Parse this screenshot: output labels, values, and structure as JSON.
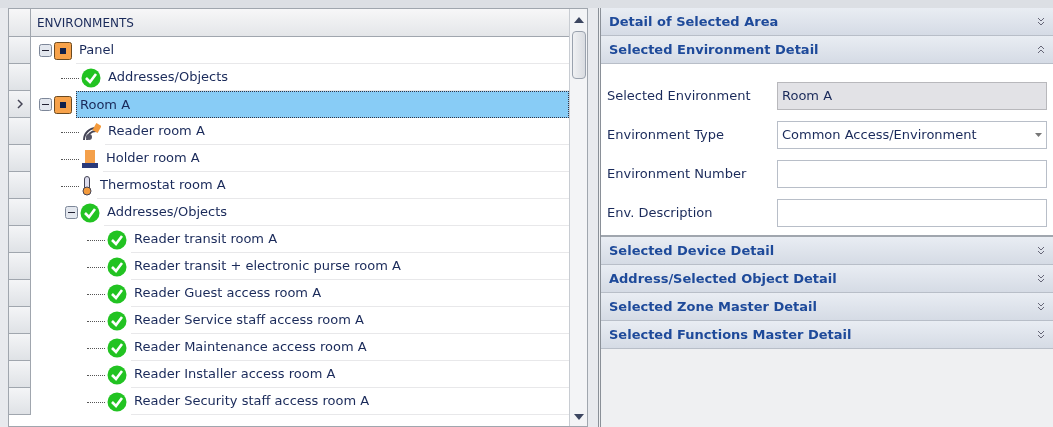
{
  "tree": {
    "header": "ENVIRONMENTS",
    "nodes": [
      {
        "label": "Panel",
        "kind": "panel",
        "expanded": true,
        "selected": false,
        "children": [
          {
            "label": "Addresses/Objects",
            "kind": "check",
            "selected": false
          }
        ]
      },
      {
        "label": "Room A",
        "kind": "panel",
        "expanded": true,
        "selected": true,
        "children": [
          {
            "label": "Reader room A",
            "kind": "reader",
            "selected": false
          },
          {
            "label": "Holder room A",
            "kind": "holder",
            "selected": false
          },
          {
            "label": "Thermostat room A",
            "kind": "thermostat",
            "selected": false
          },
          {
            "label": "Addresses/Objects",
            "kind": "check",
            "expanded": true,
            "selected": false,
            "children": [
              {
                "label": "Reader transit room A",
                "kind": "check",
                "selected": false
              },
              {
                "label": "Reader transit + electronic purse room A",
                "kind": "check",
                "selected": false
              },
              {
                "label": "Reader Guest access room A",
                "kind": "check",
                "selected": false
              },
              {
                "label": "Reader Service staff access room A",
                "kind": "check",
                "selected": false
              },
              {
                "label": "Reader Maintenance access room A",
                "kind": "check",
                "selected": false
              },
              {
                "label": "Reader Installer access room A",
                "kind": "check",
                "selected": false
              },
              {
                "label": "Reader Security staff access room A",
                "kind": "check",
                "selected": false
              }
            ]
          }
        ]
      }
    ]
  },
  "sections": [
    {
      "title": "Detail of Selected Area",
      "expanded": false
    },
    {
      "title": "Selected Environment Detail",
      "expanded": true,
      "fields": [
        {
          "label": "Selected Environment",
          "kind": "readonly",
          "value": "Room A"
        },
        {
          "label": "Environment Type",
          "kind": "dropdown",
          "value": "Common Access/Environment"
        },
        {
          "label": "Environment Number",
          "kind": "text"
        },
        {
          "label": "Env. Description",
          "kind": "text"
        }
      ]
    },
    {
      "title": "Selected Device Detail",
      "expanded": false
    },
    {
      "title": "Address/Selected Object Detail",
      "expanded": false
    },
    {
      "title": "Selected Zone Master Detail",
      "expanded": false
    },
    {
      "title": "Selected Functions Master Detail",
      "expanded": false
    }
  ]
}
